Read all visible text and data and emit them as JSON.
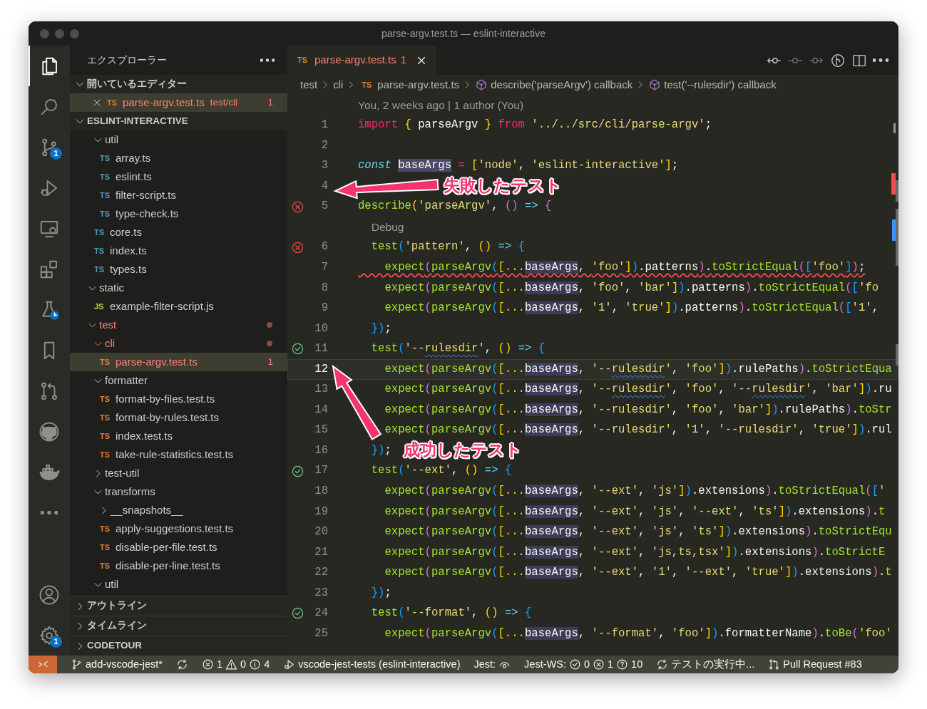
{
  "window": {
    "title": "parse-argv.test.ts — eslint-interactive"
  },
  "activity_bar": [
    {
      "kind": "files",
      "selected": true
    },
    {
      "kind": "search",
      "selected": false
    },
    {
      "kind": "source-control",
      "selected": false,
      "badge": "1"
    },
    {
      "kind": "run-debug",
      "selected": false
    },
    {
      "kind": "remote",
      "selected": false
    },
    {
      "kind": "extensions",
      "selected": false
    },
    {
      "kind": "testing",
      "selected": false
    },
    {
      "kind": "bookmark",
      "selected": false
    },
    {
      "kind": "pull-request",
      "selected": false
    },
    {
      "kind": "github",
      "selected": false
    },
    {
      "kind": "docker",
      "selected": false
    },
    {
      "kind": "more",
      "selected": false
    }
  ],
  "activity_bar_bottom": [
    {
      "kind": "account"
    },
    {
      "kind": "settings",
      "badge": "1"
    }
  ],
  "sidebar": {
    "title": "エクスプローラー",
    "open_editors": {
      "title": "開いているエディター",
      "expanded": true,
      "items": [
        {
          "icon": "TS",
          "name": "parse-argv.test.ts",
          "path": "test/cli",
          "problems": "1",
          "selected": true,
          "error": true
        }
      ]
    },
    "workspace": {
      "title": "ESLINT-INTERACTIVE",
      "expanded": true,
      "tree": [
        {
          "kind": "offscreen-parent",
          "children": [
            {
              "kind": "folder",
              "name": "util",
              "expanded": true,
              "error": false,
              "selected": false,
              "children": [
                {
                  "kind": "file",
                  "icon": "TS",
                  "color": "#519aba",
                  "name": "array.ts",
                  "error": false,
                  "selected": false
                },
                {
                  "kind": "file",
                  "icon": "TS",
                  "color": "#519aba",
                  "name": "eslint.ts",
                  "error": false,
                  "selected": false
                },
                {
                  "kind": "file",
                  "icon": "TS",
                  "color": "#519aba",
                  "name": "filter-script.ts",
                  "error": false,
                  "selected": false
                },
                {
                  "kind": "file",
                  "icon": "TS",
                  "color": "#519aba",
                  "name": "type-check.ts",
                  "error": false,
                  "selected": false
                }
              ]
            },
            {
              "kind": "file",
              "icon": "TS",
              "color": "#519aba",
              "name": "core.ts",
              "error": false,
              "selected": false
            },
            {
              "kind": "file",
              "icon": "TS",
              "color": "#519aba",
              "name": "index.ts",
              "error": false,
              "selected": false
            },
            {
              "kind": "file",
              "icon": "TS",
              "color": "#519aba",
              "name": "types.ts",
              "error": false,
              "selected": false
            }
          ]
        },
        {
          "kind": "folder",
          "name": "static",
          "expanded": true,
          "error": false,
          "selected": false,
          "children": [
            {
              "kind": "file",
              "icon": "JS",
              "color": "#cbcb41",
              "name": "example-filter-script.js",
              "error": false,
              "selected": false
            }
          ]
        },
        {
          "kind": "folder",
          "name": "test",
          "expanded": true,
          "error": true,
          "selected": false,
          "children": [
            {
              "kind": "folder",
              "name": "cli",
              "expanded": true,
              "error": true,
              "selected": false,
              "children": [
                {
                  "kind": "file",
                  "icon": "TS",
                  "color": "#e37933",
                  "name": "parse-argv.test.ts",
                  "error": true,
                  "selected": true,
                  "problems": "1"
                }
              ]
            },
            {
              "kind": "folder",
              "name": "formatter",
              "expanded": true,
              "error": false,
              "selected": false,
              "children": [
                {
                  "kind": "file",
                  "icon": "TS",
                  "color": "#e37933",
                  "name": "format-by-files.test.ts",
                  "error": false,
                  "selected": false
                },
                {
                  "kind": "file",
                  "icon": "TS",
                  "color": "#e37933",
                  "name": "format-by-rules.test.ts",
                  "error": false,
                  "selected": false
                },
                {
                  "kind": "file",
                  "icon": "TS",
                  "color": "#e37933",
                  "name": "index.test.ts",
                  "error": false,
                  "selected": false
                },
                {
                  "kind": "file",
                  "icon": "TS",
                  "color": "#e37933",
                  "name": "take-rule-statistics.test.ts",
                  "error": false,
                  "selected": false
                }
              ]
            },
            {
              "kind": "folder",
              "name": "test-util",
              "expanded": false,
              "error": false,
              "selected": false
            },
            {
              "kind": "folder",
              "name": "transforms",
              "expanded": true,
              "error": false,
              "selected": false,
              "children": [
                {
                  "kind": "folder",
                  "name": "__snapshots__",
                  "expanded": false,
                  "error": false,
                  "selected": false
                },
                {
                  "kind": "file",
                  "icon": "TS",
                  "color": "#e37933",
                  "name": "apply-suggestions.test.ts",
                  "error": false,
                  "selected": false
                },
                {
                  "kind": "file",
                  "icon": "TS",
                  "color": "#e37933",
                  "name": "disable-per-file.test.ts",
                  "error": false,
                  "selected": false
                },
                {
                  "kind": "file",
                  "icon": "TS",
                  "color": "#e37933",
                  "name": "disable-per-line.test.ts",
                  "error": false,
                  "selected": false
                }
              ]
            },
            {
              "kind": "folder",
              "name": "util",
              "expanded": true,
              "error": false,
              "selected": false
            }
          ]
        }
      ]
    },
    "sections": [
      {
        "title": "アウトライン",
        "expanded": false
      },
      {
        "title": "タイムライン",
        "expanded": false
      },
      {
        "title": "CODETOUR",
        "expanded": false
      }
    ]
  },
  "editor": {
    "tabs": [
      {
        "icon": "TS",
        "name": "parse-argv.test.ts",
        "problems": "1",
        "selected": true,
        "error": true
      }
    ],
    "toolbar": [
      {
        "kind": "commit-prev",
        "disabled": false
      },
      {
        "kind": "commit",
        "disabled": true
      },
      {
        "kind": "commit-next",
        "disabled": true
      },
      {
        "kind": "timeline",
        "disabled": false
      },
      {
        "kind": "split",
        "disabled": false
      },
      {
        "kind": "more",
        "disabled": false
      }
    ],
    "breadcrumb": [
      {
        "kind": "folder",
        "text": "test"
      },
      {
        "kind": "folder",
        "text": "cli"
      },
      {
        "kind": "file",
        "icon": "TS",
        "text": "parse-argv.test.ts"
      },
      {
        "kind": "symbol",
        "text": "describe('parseArgv') callback"
      },
      {
        "kind": "symbol",
        "text": "test('--rulesdir') callback"
      }
    ],
    "rows": [
      {
        "kind": "lens",
        "text": "You, 2 weeks ago | 1 author (You)"
      },
      {
        "kind": "code",
        "number": "1",
        "error": false,
        "current": false,
        "tokens": [
          {
            "text": "import ",
            "kind": "kw"
          },
          {
            "text": "{",
            "kind": "b1"
          },
          {
            "text": " parseArgv ",
            "kind": "plain"
          },
          {
            "text": "} ",
            "kind": "b1"
          },
          {
            "text": "from ",
            "kind": "kw"
          },
          {
            "text": "'../../src/cli/parse-argv'",
            "kind": "str"
          },
          {
            "text": ";",
            "kind": "plain"
          }
        ]
      },
      {
        "kind": "code",
        "number": "2",
        "error": false,
        "current": false
      },
      {
        "kind": "code",
        "number": "3",
        "error": false,
        "current": false,
        "tokens": [
          {
            "text": "const ",
            "kind": "it"
          },
          {
            "text": "baseArgs",
            "kind": "sel"
          },
          {
            "text": " = ",
            "kind": "kw"
          },
          {
            "text": "[",
            "kind": "b1"
          },
          {
            "text": "'node'",
            "kind": "str"
          },
          {
            "text": ", ",
            "kind": "plain"
          },
          {
            "text": "'eslint-interactive'",
            "kind": "str"
          },
          {
            "text": "]",
            "kind": "b1"
          },
          {
            "text": ";",
            "kind": "plain"
          }
        ]
      },
      {
        "kind": "code",
        "number": "4",
        "error": false,
        "current": false
      },
      {
        "kind": "code",
        "number": "5",
        "error": false,
        "current": false,
        "passed": false,
        "tokens": [
          {
            "text": "describe",
            "kind": "fn"
          },
          {
            "text": "(",
            "kind": "b1"
          },
          {
            "text": "'parseArgv'",
            "kind": "str"
          },
          {
            "text": ", ",
            "kind": "plain"
          },
          {
            "text": "() ",
            "kind": "b2"
          },
          {
            "text": "=> ",
            "kind": "op"
          },
          {
            "text": "{",
            "kind": "b2"
          }
        ]
      },
      {
        "kind": "lens",
        "text": "Debug"
      },
      {
        "kind": "code",
        "number": "6",
        "error": false,
        "current": false,
        "passed": false,
        "tokens": [
          {
            "text": "  test",
            "kind": "fn"
          },
          {
            "text": "(",
            "kind": "b3"
          },
          {
            "text": "'pattern'",
            "kind": "str"
          },
          {
            "text": ", ",
            "kind": "plain"
          },
          {
            "text": "() ",
            "kind": "b1"
          },
          {
            "text": "=> ",
            "kind": "op"
          },
          {
            "text": "{",
            "kind": "b3"
          }
        ]
      },
      {
        "kind": "code",
        "number": "7",
        "error": true,
        "current": false,
        "tokens": [
          {
            "text": "    expect",
            "kind": "fn"
          },
          {
            "text": "(",
            "kind": "b2"
          },
          {
            "text": "parseArgv",
            "kind": "fn"
          },
          {
            "text": "(",
            "kind": "b3"
          },
          {
            "text": "[...",
            "kind": "b1"
          },
          {
            "text": "baseArgs",
            "kind": "occ"
          },
          {
            "text": ", ",
            "kind": "plain"
          },
          {
            "text": "'foo'",
            "kind": "str"
          },
          {
            "text": "]",
            "kind": "b1"
          },
          {
            "text": ")",
            "kind": "b3"
          },
          {
            "text": ".patterns",
            "kind": "plain"
          },
          {
            "text": ")",
            "kind": "b2"
          },
          {
            "text": ".",
            "kind": "plain"
          },
          {
            "text": "toStrictEqual",
            "kind": "fn"
          },
          {
            "text": "(",
            "kind": "b2"
          },
          {
            "text": "[",
            "kind": "b3"
          },
          {
            "text": "'foo'",
            "kind": "str"
          },
          {
            "text": "]",
            "kind": "b3"
          },
          {
            "text": ")",
            "kind": "b2"
          },
          {
            "text": ";",
            "kind": "plain"
          }
        ]
      },
      {
        "kind": "code",
        "number": "8",
        "error": false,
        "current": false,
        "tokens": [
          {
            "text": "    expect",
            "kind": "fn"
          },
          {
            "text": "(",
            "kind": "b2"
          },
          {
            "text": "parseArgv",
            "kind": "fn"
          },
          {
            "text": "(",
            "kind": "b3"
          },
          {
            "text": "[...",
            "kind": "b1"
          },
          {
            "text": "baseArgs",
            "kind": "occ"
          },
          {
            "text": ", ",
            "kind": "plain"
          },
          {
            "text": "'foo'",
            "kind": "str"
          },
          {
            "text": ", ",
            "kind": "plain"
          },
          {
            "text": "'bar'",
            "kind": "str"
          },
          {
            "text": "]",
            "kind": "b1"
          },
          {
            "text": ")",
            "kind": "b3"
          },
          {
            "text": ".patterns",
            "kind": "plain"
          },
          {
            "text": ")",
            "kind": "b2"
          },
          {
            "text": ".",
            "kind": "plain"
          },
          {
            "text": "toStrictEqual",
            "kind": "fn"
          },
          {
            "text": "(",
            "kind": "b2"
          },
          {
            "text": "[",
            "kind": "b3"
          },
          {
            "text": "'fo",
            "kind": "str"
          }
        ]
      },
      {
        "kind": "code",
        "number": "9",
        "error": false,
        "current": false,
        "tokens": [
          {
            "text": "    expect",
            "kind": "fn"
          },
          {
            "text": "(",
            "kind": "b2"
          },
          {
            "text": "parseArgv",
            "kind": "fn"
          },
          {
            "text": "(",
            "kind": "b3"
          },
          {
            "text": "[...",
            "kind": "b1"
          },
          {
            "text": "baseArgs",
            "kind": "occ"
          },
          {
            "text": ", ",
            "kind": "plain"
          },
          {
            "text": "'1'",
            "kind": "str"
          },
          {
            "text": ", ",
            "kind": "plain"
          },
          {
            "text": "'true'",
            "kind": "str"
          },
          {
            "text": "]",
            "kind": "b1"
          },
          {
            "text": ")",
            "kind": "b3"
          },
          {
            "text": ".patterns",
            "kind": "plain"
          },
          {
            "text": ")",
            "kind": "b2"
          },
          {
            "text": ".",
            "kind": "plain"
          },
          {
            "text": "toStrictEqual",
            "kind": "fn"
          },
          {
            "text": "(",
            "kind": "b2"
          },
          {
            "text": "[",
            "kind": "b3"
          },
          {
            "text": "'1'",
            "kind": "str"
          },
          {
            "text": ",",
            "kind": "plain"
          }
        ]
      },
      {
        "kind": "code",
        "number": "10",
        "error": false,
        "current": false,
        "tokens": [
          {
            "text": "  })",
            "kind": "b3"
          },
          {
            "text": ";",
            "kind": "plain"
          }
        ]
      },
      {
        "kind": "code",
        "number": "11",
        "error": false,
        "current": false,
        "passed": true,
        "tokens": [
          {
            "text": "  test",
            "kind": "fn"
          },
          {
            "text": "(",
            "kind": "b3"
          },
          {
            "text": "'--",
            "kind": "str"
          },
          {
            "text": "rulesdir",
            "kind": "spell"
          },
          {
            "text": "'",
            "kind": "str"
          },
          {
            "text": ", ",
            "kind": "plain"
          },
          {
            "text": "() ",
            "kind": "b1"
          },
          {
            "text": "=> ",
            "kind": "op"
          },
          {
            "text": "{",
            "kind": "b3"
          }
        ]
      },
      {
        "kind": "code",
        "number": "12",
        "error": false,
        "current": true,
        "tokens": [
          {
            "text": "    expect",
            "kind": "fn"
          },
          {
            "text": "(",
            "kind": "b2"
          },
          {
            "text": "parseArgv",
            "kind": "fn"
          },
          {
            "text": "(",
            "kind": "b3"
          },
          {
            "text": "[...",
            "kind": "b1"
          },
          {
            "text": "baseArgs",
            "kind": "occ"
          },
          {
            "text": ", ",
            "kind": "plain"
          },
          {
            "text": "'--",
            "kind": "str"
          },
          {
            "text": "rulesdir",
            "kind": "spell"
          },
          {
            "text": "'",
            "kind": "str"
          },
          {
            "text": ", ",
            "kind": "plain"
          },
          {
            "text": "'foo'",
            "kind": "str"
          },
          {
            "text": "]",
            "kind": "b1"
          },
          {
            "text": ")",
            "kind": "b3"
          },
          {
            "text": ".rulePaths",
            "kind": "plain"
          },
          {
            "text": ")",
            "kind": "b2"
          },
          {
            "text": ".",
            "kind": "plain"
          },
          {
            "text": "toStrictEqua",
            "kind": "fn"
          }
        ]
      },
      {
        "kind": "code",
        "number": "13",
        "error": false,
        "current": false,
        "tokens": [
          {
            "text": "    expect",
            "kind": "fn"
          },
          {
            "text": "(",
            "kind": "b2"
          },
          {
            "text": "parseArgv",
            "kind": "fn"
          },
          {
            "text": "(",
            "kind": "b3"
          },
          {
            "text": "[...",
            "kind": "b1"
          },
          {
            "text": "baseArgs",
            "kind": "occ"
          },
          {
            "text": ", ",
            "kind": "plain"
          },
          {
            "text": "'--",
            "kind": "str"
          },
          {
            "text": "rulesdir",
            "kind": "spell"
          },
          {
            "text": "'",
            "kind": "str"
          },
          {
            "text": ", ",
            "kind": "plain"
          },
          {
            "text": "'foo'",
            "kind": "str"
          },
          {
            "text": ", ",
            "kind": "plain"
          },
          {
            "text": "'--",
            "kind": "str"
          },
          {
            "text": "rulesdir",
            "kind": "spell"
          },
          {
            "text": "'",
            "kind": "str"
          },
          {
            "text": ", ",
            "kind": "plain"
          },
          {
            "text": "'bar'",
            "kind": "str"
          },
          {
            "text": "]",
            "kind": "b1"
          },
          {
            "text": ")",
            "kind": "b3"
          },
          {
            "text": ".ru",
            "kind": "plain"
          }
        ]
      },
      {
        "kind": "code",
        "number": "14",
        "error": false,
        "current": false,
        "tokens": [
          {
            "text": "    expect",
            "kind": "fn"
          },
          {
            "text": "(",
            "kind": "b2"
          },
          {
            "text": "parseArgv",
            "kind": "fn"
          },
          {
            "text": "(",
            "kind": "b3"
          },
          {
            "text": "[...",
            "kind": "b1"
          },
          {
            "text": "baseArgs",
            "kind": "occ"
          },
          {
            "text": ", ",
            "kind": "plain"
          },
          {
            "text": "'--rulesdir'",
            "kind": "str"
          },
          {
            "text": ", ",
            "kind": "plain"
          },
          {
            "text": "'foo'",
            "kind": "str"
          },
          {
            "text": ", ",
            "kind": "plain"
          },
          {
            "text": "'bar'",
            "kind": "str"
          },
          {
            "text": "]",
            "kind": "b1"
          },
          {
            "text": ")",
            "kind": "b3"
          },
          {
            "text": ".rulePaths",
            "kind": "plain"
          },
          {
            "text": ")",
            "kind": "b2"
          },
          {
            "text": ".",
            "kind": "plain"
          },
          {
            "text": "toStr",
            "kind": "fn"
          }
        ]
      },
      {
        "kind": "code",
        "number": "15",
        "error": false,
        "current": false,
        "tokens": [
          {
            "text": "    expect",
            "kind": "fn"
          },
          {
            "text": "(",
            "kind": "b2"
          },
          {
            "text": "parseArgv",
            "kind": "fn"
          },
          {
            "text": "(",
            "kind": "b3"
          },
          {
            "text": "[...",
            "kind": "b1"
          },
          {
            "text": "baseArgs",
            "kind": "occ"
          },
          {
            "text": ", ",
            "kind": "plain"
          },
          {
            "text": "'--rulesdir'",
            "kind": "str"
          },
          {
            "text": ", ",
            "kind": "plain"
          },
          {
            "text": "'1'",
            "kind": "str"
          },
          {
            "text": ", ",
            "kind": "plain"
          },
          {
            "text": "'--rulesdir'",
            "kind": "str"
          },
          {
            "text": ", ",
            "kind": "plain"
          },
          {
            "text": "'true'",
            "kind": "str"
          },
          {
            "text": "]",
            "kind": "b1"
          },
          {
            "text": ")",
            "kind": "b3"
          },
          {
            "text": ".rul",
            "kind": "plain"
          }
        ]
      },
      {
        "kind": "code",
        "number": "16",
        "error": false,
        "current": false,
        "tokens": [
          {
            "text": "  })",
            "kind": "b3"
          },
          {
            "text": ";",
            "kind": "plain"
          }
        ]
      },
      {
        "kind": "code",
        "number": "17",
        "error": false,
        "current": false,
        "passed": true,
        "tokens": [
          {
            "text": "  test",
            "kind": "fn"
          },
          {
            "text": "(",
            "kind": "b3"
          },
          {
            "text": "'--ext'",
            "kind": "str"
          },
          {
            "text": ", ",
            "kind": "plain"
          },
          {
            "text": "() ",
            "kind": "b1"
          },
          {
            "text": "=> ",
            "kind": "op"
          },
          {
            "text": "{",
            "kind": "b3"
          }
        ]
      },
      {
        "kind": "code",
        "number": "18",
        "error": false,
        "current": false,
        "tokens": [
          {
            "text": "    expect",
            "kind": "fn"
          },
          {
            "text": "(",
            "kind": "b2"
          },
          {
            "text": "parseArgv",
            "kind": "fn"
          },
          {
            "text": "(",
            "kind": "b3"
          },
          {
            "text": "[...",
            "kind": "b1"
          },
          {
            "text": "baseArgs",
            "kind": "occ"
          },
          {
            "text": ", ",
            "kind": "plain"
          },
          {
            "text": "'--ext'",
            "kind": "str"
          },
          {
            "text": ", ",
            "kind": "plain"
          },
          {
            "text": "'js'",
            "kind": "str"
          },
          {
            "text": "]",
            "kind": "b1"
          },
          {
            "text": ")",
            "kind": "b3"
          },
          {
            "text": ".extensions",
            "kind": "plain"
          },
          {
            "text": ")",
            "kind": "b2"
          },
          {
            "text": ".",
            "kind": "plain"
          },
          {
            "text": "toStrictEqual",
            "kind": "fn"
          },
          {
            "text": "(",
            "kind": "b2"
          },
          {
            "text": "[",
            "kind": "b3"
          },
          {
            "text": "'",
            "kind": "str"
          }
        ]
      },
      {
        "kind": "code",
        "number": "19",
        "error": false,
        "current": false,
        "tokens": [
          {
            "text": "    expect",
            "kind": "fn"
          },
          {
            "text": "(",
            "kind": "b2"
          },
          {
            "text": "parseArgv",
            "kind": "fn"
          },
          {
            "text": "(",
            "kind": "b3"
          },
          {
            "text": "[...",
            "kind": "b1"
          },
          {
            "text": "baseArgs",
            "kind": "occ"
          },
          {
            "text": ", ",
            "kind": "plain"
          },
          {
            "text": "'--ext'",
            "kind": "str"
          },
          {
            "text": ", ",
            "kind": "plain"
          },
          {
            "text": "'js'",
            "kind": "str"
          },
          {
            "text": ", ",
            "kind": "plain"
          },
          {
            "text": "'--ext'",
            "kind": "str"
          },
          {
            "text": ", ",
            "kind": "plain"
          },
          {
            "text": "'ts'",
            "kind": "str"
          },
          {
            "text": "]",
            "kind": "b1"
          },
          {
            "text": ")",
            "kind": "b3"
          },
          {
            "text": ".extensions",
            "kind": "plain"
          },
          {
            "text": ")",
            "kind": "b2"
          },
          {
            "text": ".",
            "kind": "plain"
          },
          {
            "text": "t",
            "kind": "fn"
          }
        ]
      },
      {
        "kind": "code",
        "number": "20",
        "error": false,
        "current": false,
        "tokens": [
          {
            "text": "    expect",
            "kind": "fn"
          },
          {
            "text": "(",
            "kind": "b2"
          },
          {
            "text": "parseArgv",
            "kind": "fn"
          },
          {
            "text": "(",
            "kind": "b3"
          },
          {
            "text": "[...",
            "kind": "b1"
          },
          {
            "text": "baseArgs",
            "kind": "occ"
          },
          {
            "text": ", ",
            "kind": "plain"
          },
          {
            "text": "'--ext'",
            "kind": "str"
          },
          {
            "text": ", ",
            "kind": "plain"
          },
          {
            "text": "'js'",
            "kind": "str"
          },
          {
            "text": ", ",
            "kind": "plain"
          },
          {
            "text": "'ts'",
            "kind": "str"
          },
          {
            "text": "]",
            "kind": "b1"
          },
          {
            "text": ")",
            "kind": "b3"
          },
          {
            "text": ".extensions",
            "kind": "plain"
          },
          {
            "text": ")",
            "kind": "b2"
          },
          {
            "text": ".",
            "kind": "plain"
          },
          {
            "text": "toStrictEqu",
            "kind": "fn"
          }
        ]
      },
      {
        "kind": "code",
        "number": "21",
        "error": false,
        "current": false,
        "tokens": [
          {
            "text": "    expect",
            "kind": "fn"
          },
          {
            "text": "(",
            "kind": "b2"
          },
          {
            "text": "parseArgv",
            "kind": "fn"
          },
          {
            "text": "(",
            "kind": "b3"
          },
          {
            "text": "[...",
            "kind": "b1"
          },
          {
            "text": "baseArgs",
            "kind": "occ"
          },
          {
            "text": ", ",
            "kind": "plain"
          },
          {
            "text": "'--ext'",
            "kind": "str"
          },
          {
            "text": ", ",
            "kind": "plain"
          },
          {
            "text": "'js,ts,tsx'",
            "kind": "str"
          },
          {
            "text": "]",
            "kind": "b1"
          },
          {
            "text": ")",
            "kind": "b3"
          },
          {
            "text": ".extensions",
            "kind": "plain"
          },
          {
            "text": ")",
            "kind": "b2"
          },
          {
            "text": ".",
            "kind": "plain"
          },
          {
            "text": "toStrictE",
            "kind": "fn"
          }
        ]
      },
      {
        "kind": "code",
        "number": "22",
        "error": false,
        "current": false,
        "tokens": [
          {
            "text": "    expect",
            "kind": "fn"
          },
          {
            "text": "(",
            "kind": "b2"
          },
          {
            "text": "parseArgv",
            "kind": "fn"
          },
          {
            "text": "(",
            "kind": "b3"
          },
          {
            "text": "[...",
            "kind": "b1"
          },
          {
            "text": "baseArgs",
            "kind": "occ"
          },
          {
            "text": ", ",
            "kind": "plain"
          },
          {
            "text": "'--ext'",
            "kind": "str"
          },
          {
            "text": ", ",
            "kind": "plain"
          },
          {
            "text": "'1'",
            "kind": "str"
          },
          {
            "text": ", ",
            "kind": "plain"
          },
          {
            "text": "'--ext'",
            "kind": "str"
          },
          {
            "text": ", ",
            "kind": "plain"
          },
          {
            "text": "'true'",
            "kind": "str"
          },
          {
            "text": "]",
            "kind": "b1"
          },
          {
            "text": ")",
            "kind": "b3"
          },
          {
            "text": ".extensions",
            "kind": "plain"
          },
          {
            "text": ")",
            "kind": "b2"
          },
          {
            "text": ".",
            "kind": "plain"
          },
          {
            "text": "t",
            "kind": "fn"
          }
        ]
      },
      {
        "kind": "code",
        "number": "23",
        "error": false,
        "current": false,
        "tokens": [
          {
            "text": "  })",
            "kind": "b3"
          },
          {
            "text": ";",
            "kind": "plain"
          }
        ]
      },
      {
        "kind": "code",
        "number": "24",
        "error": false,
        "current": false,
        "passed": true,
        "tokens": [
          {
            "text": "  test",
            "kind": "fn"
          },
          {
            "text": "(",
            "kind": "b3"
          },
          {
            "text": "'--format'",
            "kind": "str"
          },
          {
            "text": ", ",
            "kind": "plain"
          },
          {
            "text": "() ",
            "kind": "b1"
          },
          {
            "text": "=> ",
            "kind": "op"
          },
          {
            "text": "{",
            "kind": "b3"
          }
        ]
      },
      {
        "kind": "code",
        "number": "25",
        "error": false,
        "current": false,
        "tokens": [
          {
            "text": "    expect",
            "kind": "fn"
          },
          {
            "text": "(",
            "kind": "b2"
          },
          {
            "text": "parseArgv",
            "kind": "fn"
          },
          {
            "text": "(",
            "kind": "b3"
          },
          {
            "text": "[...",
            "kind": "b1"
          },
          {
            "text": "baseArgs",
            "kind": "occ"
          },
          {
            "text": ", ",
            "kind": "plain"
          },
          {
            "text": "'--format'",
            "kind": "str"
          },
          {
            "text": ", ",
            "kind": "plain"
          },
          {
            "text": "'foo'",
            "kind": "str"
          },
          {
            "text": "]",
            "kind": "b1"
          },
          {
            "text": ")",
            "kind": "b3"
          },
          {
            "text": ".formatterName",
            "kind": "plain"
          },
          {
            "text": ")",
            "kind": "b2"
          },
          {
            "text": ".",
            "kind": "plain"
          },
          {
            "text": "toBe",
            "kind": "fn"
          },
          {
            "text": "(",
            "kind": "b2"
          },
          {
            "text": "'foo'",
            "kind": "str"
          }
        ]
      }
    ]
  },
  "status_bar": [
    {
      "kind": "remote",
      "parts": [
        {
          "kind": "remote"
        }
      ]
    },
    {
      "kind": "branch",
      "parts": [
        {
          "kind": "branch"
        },
        {
          "kind": "text",
          "text": "add-vscode-jest*"
        }
      ]
    },
    {
      "kind": "sync",
      "parts": [
        {
          "kind": "sync"
        }
      ]
    },
    {
      "kind": "problems",
      "parts": [
        {
          "kind": "error"
        },
        {
          "kind": "text",
          "text": "1"
        },
        {
          "kind": "warning"
        },
        {
          "kind": "text",
          "text": "0"
        },
        {
          "kind": "info"
        },
        {
          "kind": "text",
          "text": "4"
        }
      ]
    },
    {
      "kind": "debug",
      "parts": [
        {
          "kind": "debug"
        },
        {
          "kind": "text",
          "text": "vscode-jest-tests (eslint-interactive)"
        }
      ]
    },
    {
      "kind": "jest",
      "parts": [
        {
          "kind": "text",
          "text": "Jest:"
        },
        {
          "kind": "eye"
        }
      ]
    },
    {
      "kind": "jest-ws",
      "parts": [
        {
          "kind": "text",
          "text": "Jest-WS:"
        },
        {
          "kind": "pass"
        },
        {
          "kind": "text",
          "text": "0"
        },
        {
          "kind": "error"
        },
        {
          "kind": "text",
          "text": "1"
        },
        {
          "kind": "help"
        },
        {
          "kind": "text",
          "text": "10"
        }
      ]
    },
    {
      "kind": "test-run",
      "parts": [
        {
          "kind": "sync"
        },
        {
          "kind": "text",
          "text": "テストの実行中..."
        }
      ]
    },
    {
      "kind": "pull-request",
      "parts": [
        {
          "kind": "pull-request"
        },
        {
          "kind": "text",
          "text": "Pull Request #83"
        }
      ]
    }
  ],
  "annotations": [
    {
      "text": "失敗したテスト"
    },
    {
      "text": "成功したテスト"
    }
  ]
}
